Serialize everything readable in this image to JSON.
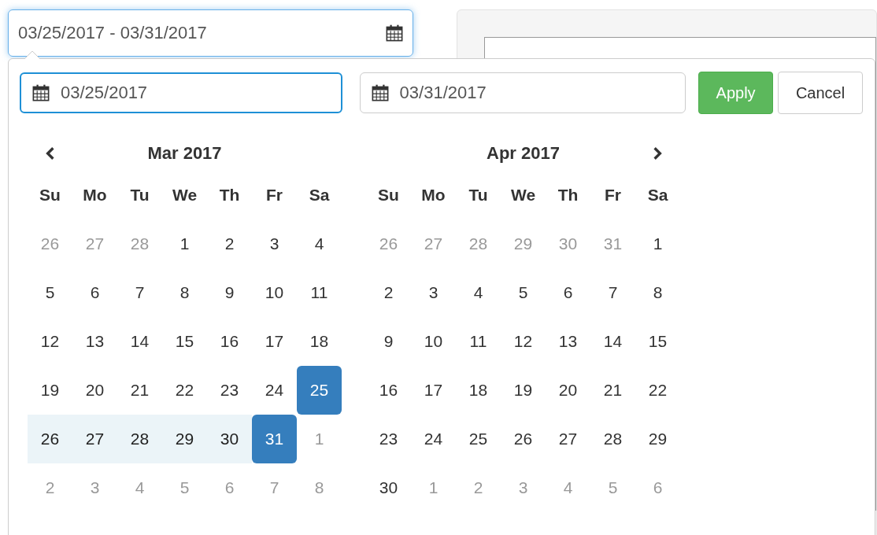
{
  "range_field": {
    "value": "03/25/2017 - 03/31/2017"
  },
  "start_field": {
    "value": "03/25/2017",
    "focused": true
  },
  "end_field": {
    "value": "03/31/2017",
    "focused": false
  },
  "buttons": [
    {
      "label": "Apply",
      "kind": "primary"
    },
    {
      "label": "Cancel",
      "kind": "default"
    }
  ],
  "calendars": [
    {
      "title": "Mar 2017",
      "prev_arrow": true,
      "weekdays": [
        "Su",
        "Mo",
        "Tu",
        "We",
        "Th",
        "Fr",
        "Sa"
      ],
      "weeks": [
        [
          {
            "day": "26",
            "off": true,
            "in_range": false,
            "selected": false
          },
          {
            "day": "27",
            "off": true,
            "in_range": false,
            "selected": false
          },
          {
            "day": "28",
            "off": true,
            "in_range": false,
            "selected": false
          },
          {
            "day": "1",
            "off": false,
            "in_range": false,
            "selected": false
          },
          {
            "day": "2",
            "off": false,
            "in_range": false,
            "selected": false
          },
          {
            "day": "3",
            "off": false,
            "in_range": false,
            "selected": false
          },
          {
            "day": "4",
            "off": false,
            "in_range": false,
            "selected": false
          }
        ],
        [
          {
            "day": "5",
            "off": false,
            "in_range": false,
            "selected": false
          },
          {
            "day": "6",
            "off": false,
            "in_range": false,
            "selected": false
          },
          {
            "day": "7",
            "off": false,
            "in_range": false,
            "selected": false
          },
          {
            "day": "8",
            "off": false,
            "in_range": false,
            "selected": false
          },
          {
            "day": "9",
            "off": false,
            "in_range": false,
            "selected": false
          },
          {
            "day": "10",
            "off": false,
            "in_range": false,
            "selected": false
          },
          {
            "day": "11",
            "off": false,
            "in_range": false,
            "selected": false
          }
        ],
        [
          {
            "day": "12",
            "off": false,
            "in_range": false,
            "selected": false
          },
          {
            "day": "13",
            "off": false,
            "in_range": false,
            "selected": false
          },
          {
            "day": "14",
            "off": false,
            "in_range": false,
            "selected": false
          },
          {
            "day": "15",
            "off": false,
            "in_range": false,
            "selected": false
          },
          {
            "day": "16",
            "off": false,
            "in_range": false,
            "selected": false
          },
          {
            "day": "17",
            "off": false,
            "in_range": false,
            "selected": false
          },
          {
            "day": "18",
            "off": false,
            "in_range": false,
            "selected": false
          }
        ],
        [
          {
            "day": "19",
            "off": false,
            "in_range": false,
            "selected": false
          },
          {
            "day": "20",
            "off": false,
            "in_range": false,
            "selected": false
          },
          {
            "day": "21",
            "off": false,
            "in_range": false,
            "selected": false
          },
          {
            "day": "22",
            "off": false,
            "in_range": false,
            "selected": false
          },
          {
            "day": "23",
            "off": false,
            "in_range": false,
            "selected": false
          },
          {
            "day": "24",
            "off": false,
            "in_range": false,
            "selected": false
          },
          {
            "day": "25",
            "off": false,
            "in_range": false,
            "selected": true
          }
        ],
        [
          {
            "day": "26",
            "off": false,
            "in_range": true,
            "selected": false
          },
          {
            "day": "27",
            "off": false,
            "in_range": true,
            "selected": false
          },
          {
            "day": "28",
            "off": false,
            "in_range": true,
            "selected": false
          },
          {
            "day": "29",
            "off": false,
            "in_range": true,
            "selected": false
          },
          {
            "day": "30",
            "off": false,
            "in_range": true,
            "selected": false
          },
          {
            "day": "31",
            "off": false,
            "in_range": false,
            "selected": true
          },
          {
            "day": "1",
            "off": true,
            "in_range": false,
            "selected": false
          }
        ],
        [
          {
            "day": "2",
            "off": true,
            "in_range": false,
            "selected": false
          },
          {
            "day": "3",
            "off": true,
            "in_range": false,
            "selected": false
          },
          {
            "day": "4",
            "off": true,
            "in_range": false,
            "selected": false
          },
          {
            "day": "5",
            "off": true,
            "in_range": false,
            "selected": false
          },
          {
            "day": "6",
            "off": true,
            "in_range": false,
            "selected": false
          },
          {
            "day": "7",
            "off": true,
            "in_range": false,
            "selected": false
          },
          {
            "day": "8",
            "off": true,
            "in_range": false,
            "selected": false
          }
        ]
      ]
    },
    {
      "title": "Apr 2017",
      "next_arrow": true,
      "weekdays": [
        "Su",
        "Mo",
        "Tu",
        "We",
        "Th",
        "Fr",
        "Sa"
      ],
      "weeks": [
        [
          {
            "day": "26",
            "off": true,
            "in_range": false,
            "selected": false
          },
          {
            "day": "27",
            "off": true,
            "in_range": false,
            "selected": false
          },
          {
            "day": "28",
            "off": true,
            "in_range": false,
            "selected": false
          },
          {
            "day": "29",
            "off": true,
            "in_range": false,
            "selected": false
          },
          {
            "day": "30",
            "off": true,
            "in_range": false,
            "selected": false
          },
          {
            "day": "31",
            "off": true,
            "in_range": false,
            "selected": false
          },
          {
            "day": "1",
            "off": false,
            "in_range": false,
            "selected": false
          }
        ],
        [
          {
            "day": "2",
            "off": false,
            "in_range": false,
            "selected": false
          },
          {
            "day": "3",
            "off": false,
            "in_range": false,
            "selected": false
          },
          {
            "day": "4",
            "off": false,
            "in_range": false,
            "selected": false
          },
          {
            "day": "5",
            "off": false,
            "in_range": false,
            "selected": false
          },
          {
            "day": "6",
            "off": false,
            "in_range": false,
            "selected": false
          },
          {
            "day": "7",
            "off": false,
            "in_range": false,
            "selected": false
          },
          {
            "day": "8",
            "off": false,
            "in_range": false,
            "selected": false
          }
        ],
        [
          {
            "day": "9",
            "off": false,
            "in_range": false,
            "selected": false
          },
          {
            "day": "10",
            "off": false,
            "in_range": false,
            "selected": false
          },
          {
            "day": "11",
            "off": false,
            "in_range": false,
            "selected": false
          },
          {
            "day": "12",
            "off": false,
            "in_range": false,
            "selected": false
          },
          {
            "day": "13",
            "off": false,
            "in_range": false,
            "selected": false
          },
          {
            "day": "14",
            "off": false,
            "in_range": false,
            "selected": false
          },
          {
            "day": "15",
            "off": false,
            "in_range": false,
            "selected": false
          }
        ],
        [
          {
            "day": "16",
            "off": false,
            "in_range": false,
            "selected": false
          },
          {
            "day": "17",
            "off": false,
            "in_range": false,
            "selected": false
          },
          {
            "day": "18",
            "off": false,
            "in_range": false,
            "selected": false
          },
          {
            "day": "19",
            "off": false,
            "in_range": false,
            "selected": false
          },
          {
            "day": "20",
            "off": false,
            "in_range": false,
            "selected": false
          },
          {
            "day": "21",
            "off": false,
            "in_range": false,
            "selected": false
          },
          {
            "day": "22",
            "off": false,
            "in_range": false,
            "selected": false
          }
        ],
        [
          {
            "day": "23",
            "off": false,
            "in_range": false,
            "selected": false
          },
          {
            "day": "24",
            "off": false,
            "in_range": false,
            "selected": false
          },
          {
            "day": "25",
            "off": false,
            "in_range": false,
            "selected": false
          },
          {
            "day": "26",
            "off": false,
            "in_range": false,
            "selected": false
          },
          {
            "day": "27",
            "off": false,
            "in_range": false,
            "selected": false
          },
          {
            "day": "28",
            "off": false,
            "in_range": false,
            "selected": false
          },
          {
            "day": "29",
            "off": false,
            "in_range": false,
            "selected": false
          }
        ],
        [
          {
            "day": "30",
            "off": false,
            "in_range": false,
            "selected": false
          },
          {
            "day": "1",
            "off": true,
            "in_range": false,
            "selected": false
          },
          {
            "day": "2",
            "off": true,
            "in_range": false,
            "selected": false
          },
          {
            "day": "3",
            "off": true,
            "in_range": false,
            "selected": false
          },
          {
            "day": "4",
            "off": true,
            "in_range": false,
            "selected": false
          },
          {
            "day": "5",
            "off": true,
            "in_range": false,
            "selected": false
          },
          {
            "day": "6",
            "off": true,
            "in_range": false,
            "selected": false
          }
        ]
      ]
    }
  ]
}
